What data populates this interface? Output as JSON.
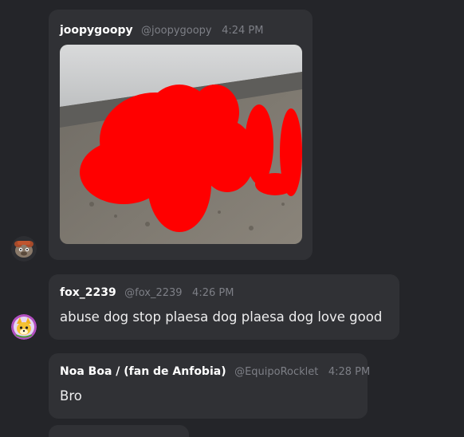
{
  "messages": [
    {
      "display_name": "joopygoopy",
      "handle": "@joopygoopy",
      "time": "4:24 PM",
      "avatar_icon": "cartoon-dog-avatar-icon",
      "attachment": {
        "type": "image",
        "description_icon": "redacted-photo-icon"
      }
    },
    {
      "display_name": "fox_2239",
      "handle": "@fox_2239",
      "time": "4:26 PM",
      "avatar_icon": "cartoon-fox-avatar-icon",
      "text": "abuse dog stop plaesa dog  plaesa dog love good"
    },
    {
      "display_name": "Noa Boa / (fan de Anfobia)",
      "handle": "@EquipoRocklet",
      "time": "4:28 PM",
      "text": "Bro"
    }
  ],
  "colors": {
    "background": "#242529",
    "bubble": "#303135",
    "muted_text": "#7d7f86",
    "redaction": "#ff0000"
  }
}
